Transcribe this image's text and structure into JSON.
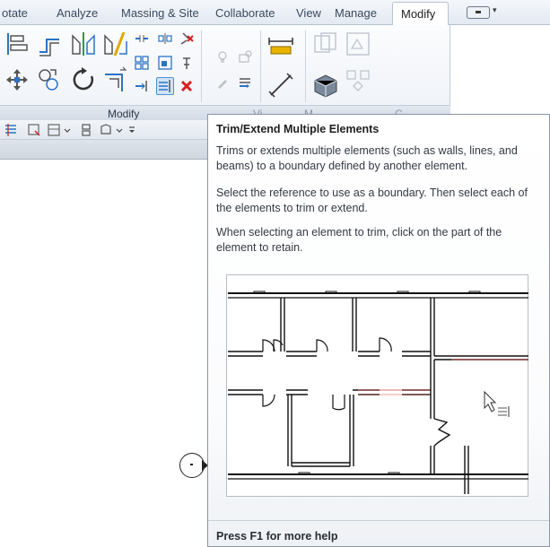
{
  "ribbon": {
    "tabs": [
      "otate",
      "Analyze",
      "Massing & Site",
      "Collaborate",
      "View",
      "Manage"
    ],
    "active_tab": "Modify",
    "panel_titles": {
      "modify": "Modify",
      "view": "Vi",
      "measure": "M",
      "create": "C"
    }
  },
  "tooltip": {
    "title": "Trim/Extend Multiple Elements",
    "description": "Trims or extends multiple elements (such as walls, lines, and beams) to a boundary defined by another element.",
    "instruction_1": "Select the reference to use as a boundary. Then select each of the elements to trim or extend.",
    "instruction_2": "When selecting an element to trim, click on the part of the element to retain.",
    "footer": "Press F1 for more help"
  },
  "icons": {
    "align": "align-icon",
    "offset": "offset-icon",
    "mirror_axis": "mirror-pick-axis-icon",
    "mirror_draw": "mirror-draw-axis-icon",
    "move": "move-icon",
    "copy": "copy-icon",
    "rotate": "rotate-icon",
    "trim_corner": "trim-extend-corner-icon",
    "split": "split-element-icon",
    "split_gap": "split-with-gap-icon",
    "unpin": "unpin-icon",
    "array": "array-icon",
    "scale": "scale-icon",
    "pin": "pin-icon",
    "trim_single": "trim-extend-single-icon",
    "trim_multiple": "trim-extend-multiple-icon",
    "delete": "delete-icon"
  },
  "colors": {
    "ribbon_bg": "#eef2f7",
    "active_tool_highlight": "#cfe3f7",
    "delete_red": "#d81e1e",
    "tooltip_border": "#8b97a6"
  }
}
